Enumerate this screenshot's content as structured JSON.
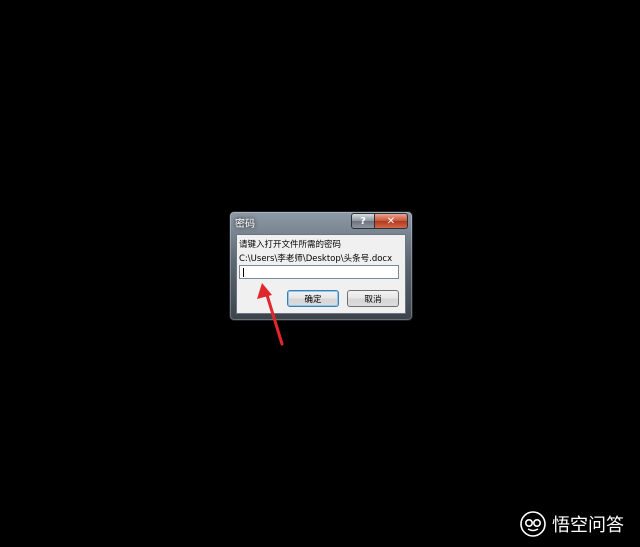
{
  "dialog": {
    "title": "密码",
    "help_label": "?",
    "close_label": "✕",
    "prompt": "请键入打开文件所需的密码",
    "file_path": "C:\\Users\\李老师\\Desktop\\头条号.docx",
    "password_value": "",
    "ok_label": "确定",
    "cancel_label": "取消"
  },
  "watermark": {
    "text": "悟空问答"
  },
  "colors": {
    "background": "#000000",
    "arrow": "#e0282c"
  }
}
